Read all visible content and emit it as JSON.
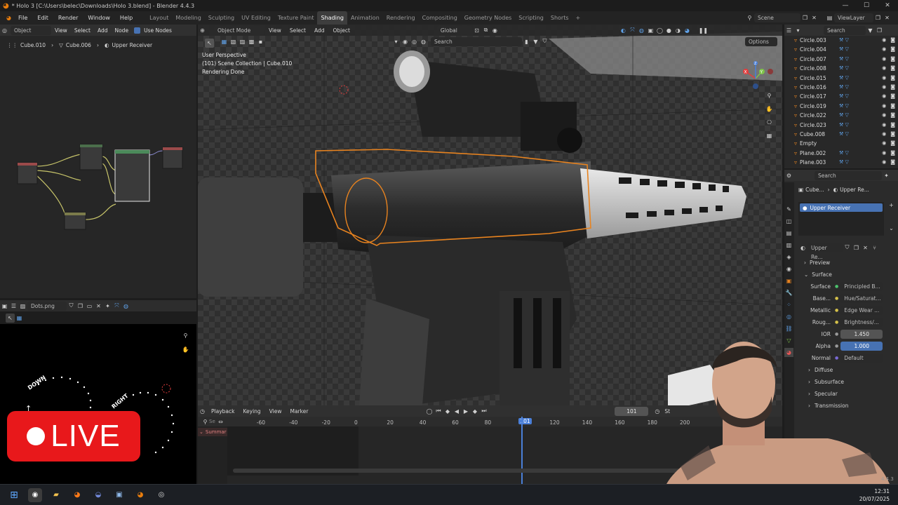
{
  "window": {
    "title": "* Holo 3 [C:\\Users\\belec\\Downloads\\Holo 3.blend] - Blender 4.4.3",
    "controls": [
      "—",
      "☐",
      "✕"
    ]
  },
  "menu": [
    "File",
    "Edit",
    "Render",
    "Window",
    "Help"
  ],
  "workspaces": [
    "Layout",
    "Modeling",
    "Sculpting",
    "UV Editing",
    "Texture Paint",
    "Shading",
    "Animation",
    "Rendering",
    "Compositing",
    "Geometry Nodes",
    "Scripting",
    "Shorts"
  ],
  "active_workspace": "Shading",
  "scene": {
    "name": "Scene",
    "view_layer": "ViewLayer"
  },
  "node_editor": {
    "object_mode": "Object",
    "menu": [
      "View",
      "Select",
      "Add",
      "Node"
    ],
    "use_nodes": "Use Nodes",
    "breadcrumb": [
      "Cube.010",
      "Cube.006",
      "Upper Receiver"
    ]
  },
  "image_editor": {
    "image": "Dots.png",
    "overlay_labels": [
      "DOWN",
      "RIGHT"
    ]
  },
  "live_badge": "LIVE",
  "viewport": {
    "mode": "Object Mode",
    "menu": [
      "View",
      "Select",
      "Add",
      "Object"
    ],
    "orientation": "Global",
    "search_placeholder": "Search",
    "options": "Options",
    "info_lines": [
      "User Perspective",
      "(101) Scene Collection | Cube.010",
      "Rendering Done"
    ],
    "gizmo_axes": [
      "X",
      "Y",
      "Z"
    ]
  },
  "outliner": {
    "search_placeholder": "Search",
    "items": [
      "Circle.003",
      "Circle.004",
      "Circle.007",
      "Circle.008",
      "Circle.015",
      "Circle.016",
      "Circle.017",
      "Circle.019",
      "Circle.022",
      "Circle.023",
      "Cube.008",
      "Empty",
      "Plane.002",
      "Plane.003"
    ]
  },
  "properties": {
    "search_placeholder": "Search",
    "breadcrumb": [
      "Cube...",
      "Upper Re..."
    ],
    "material_slot": "Upper Receiver",
    "material_name": "Upper Re...",
    "sections": {
      "preview": "Preview",
      "surface": "Surface"
    },
    "rows": [
      {
        "label": "Surface",
        "value": "Principled B..."
      },
      {
        "label": "Base...",
        "value": "Hue/Saturat..."
      },
      {
        "label": "Metallic",
        "value": "Edge Wear ..."
      },
      {
        "label": "Roug...",
        "value": "Brightness/..."
      },
      {
        "label": "IOR",
        "value": "1.450"
      },
      {
        "label": "Alpha",
        "value": "1.000"
      },
      {
        "label": "Normal",
        "value": "Default"
      }
    ],
    "subsections": [
      "Diffuse",
      "Subsurface",
      "Specular",
      "Transmission"
    ]
  },
  "timeline": {
    "menu": [
      "Playback",
      "Keying",
      "View",
      "Marker"
    ],
    "current_frame": "101",
    "frame_labels": [
      "-60",
      "-40",
      "-20",
      "0",
      "20",
      "40",
      "60",
      "80",
      "101",
      "120",
      "140",
      "160",
      "180",
      "200"
    ],
    "summary": "Summar",
    "search": "Se",
    "start_label": "St"
  },
  "status": {
    "version": "4.4.3"
  },
  "taskbar": {
    "time": "12:31",
    "date": "20/07/2025"
  },
  "colors": {
    "accent": "#4772b3",
    "selection_outline": "#e8831f",
    "live_red": "#e8181b",
    "active_blue": "#4a7fd8"
  }
}
